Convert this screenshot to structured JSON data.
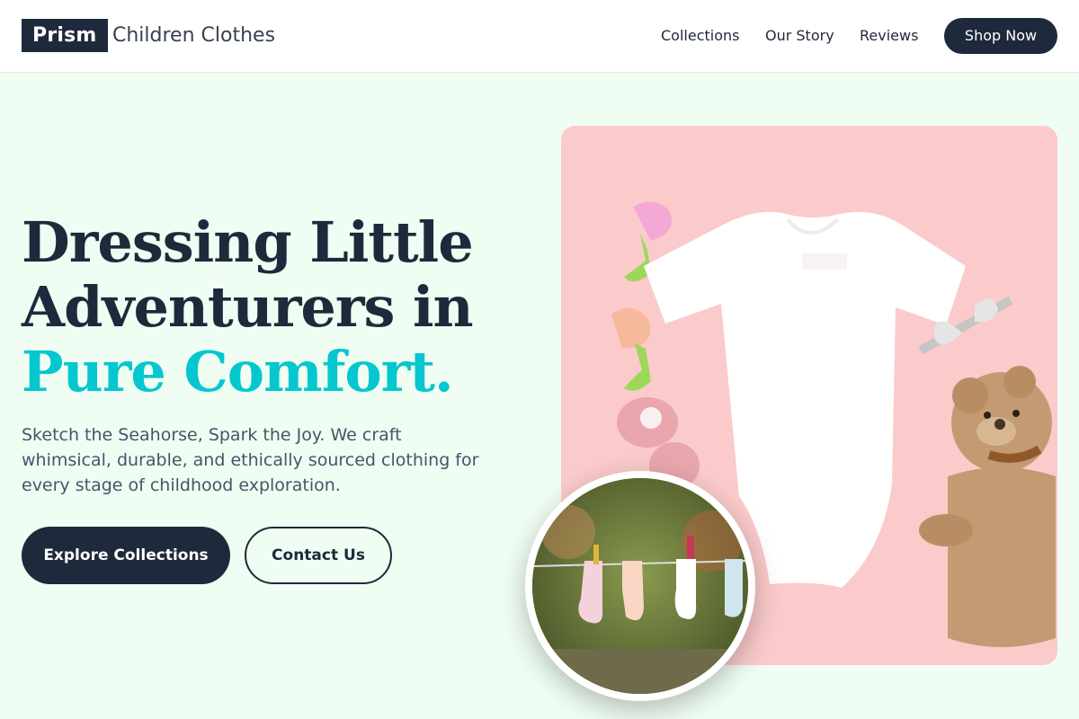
{
  "header": {
    "brand": "Prism",
    "brand_subtitle": "Children Clothes",
    "nav": [
      "Collections",
      "Our Story",
      "Reviews"
    ],
    "cta": "Shop Now"
  },
  "hero": {
    "headline_line1": "Dressing Little",
    "headline_line2": "Adventurers in",
    "headline_accent": "Pure Comfort.",
    "description": "Sketch the Seahorse, Spark the Joy. We craft whimsical, durable, and ethically sourced clothing for every stage of childhood exploration.",
    "primary_button": "Explore Collections",
    "secondary_button": "Contact Us"
  },
  "colors": {
    "background": "#effdf2",
    "dark": "#1e293b",
    "accent": "#06c7cf",
    "card_pink": "#fbcaca"
  },
  "images": {
    "main": "baby-onesie-flatlay",
    "inset": "socks-on-clothesline"
  }
}
